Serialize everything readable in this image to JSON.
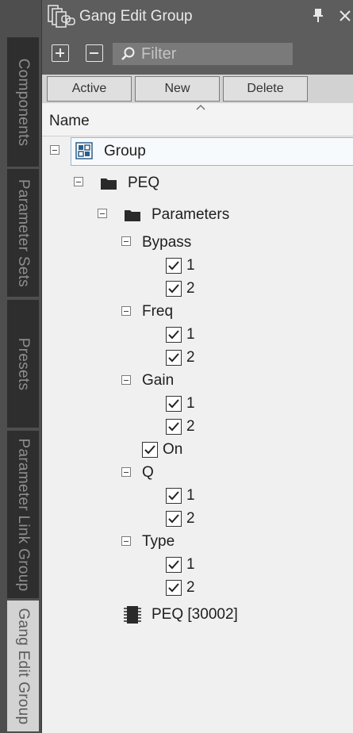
{
  "window": {
    "title": "Gang Edit Group"
  },
  "side_tabs": [
    {
      "label": "Components",
      "active": false
    },
    {
      "label": "Parameter Sets",
      "active": false
    },
    {
      "label": "Presets",
      "active": false
    },
    {
      "label": "Parameter Link Group",
      "active": false
    },
    {
      "label": "Gang Edit Group",
      "active": true
    }
  ],
  "toolbar": {
    "filter_placeholder": "Filter",
    "filter_value": ""
  },
  "actions": {
    "active_label": "Active",
    "new_label": "New",
    "delete_label": "Delete"
  },
  "table": {
    "column_name": "Name"
  },
  "tree": {
    "group": {
      "label": "Group"
    },
    "peq": {
      "label": "PEQ"
    },
    "parameters": {
      "label": "Parameters"
    },
    "bypass": {
      "label": "Bypass",
      "ch1": "1",
      "ch2": "2"
    },
    "freq": {
      "label": "Freq",
      "ch1": "1",
      "ch2": "2"
    },
    "gain": {
      "label": "Gain",
      "ch1": "1",
      "ch2": "2"
    },
    "on": {
      "label": "On"
    },
    "q": {
      "label": "Q",
      "ch1": "1",
      "ch2": "2"
    },
    "type": {
      "label": "Type",
      "ch1": "1",
      "ch2": "2"
    },
    "component": {
      "label": "PEQ [30002]"
    }
  },
  "colors": {
    "accent_selection": "#8fb8d8",
    "tab_active_bg": "#d3d3d3",
    "tab_inactive_bg": "#2e2e2e"
  }
}
